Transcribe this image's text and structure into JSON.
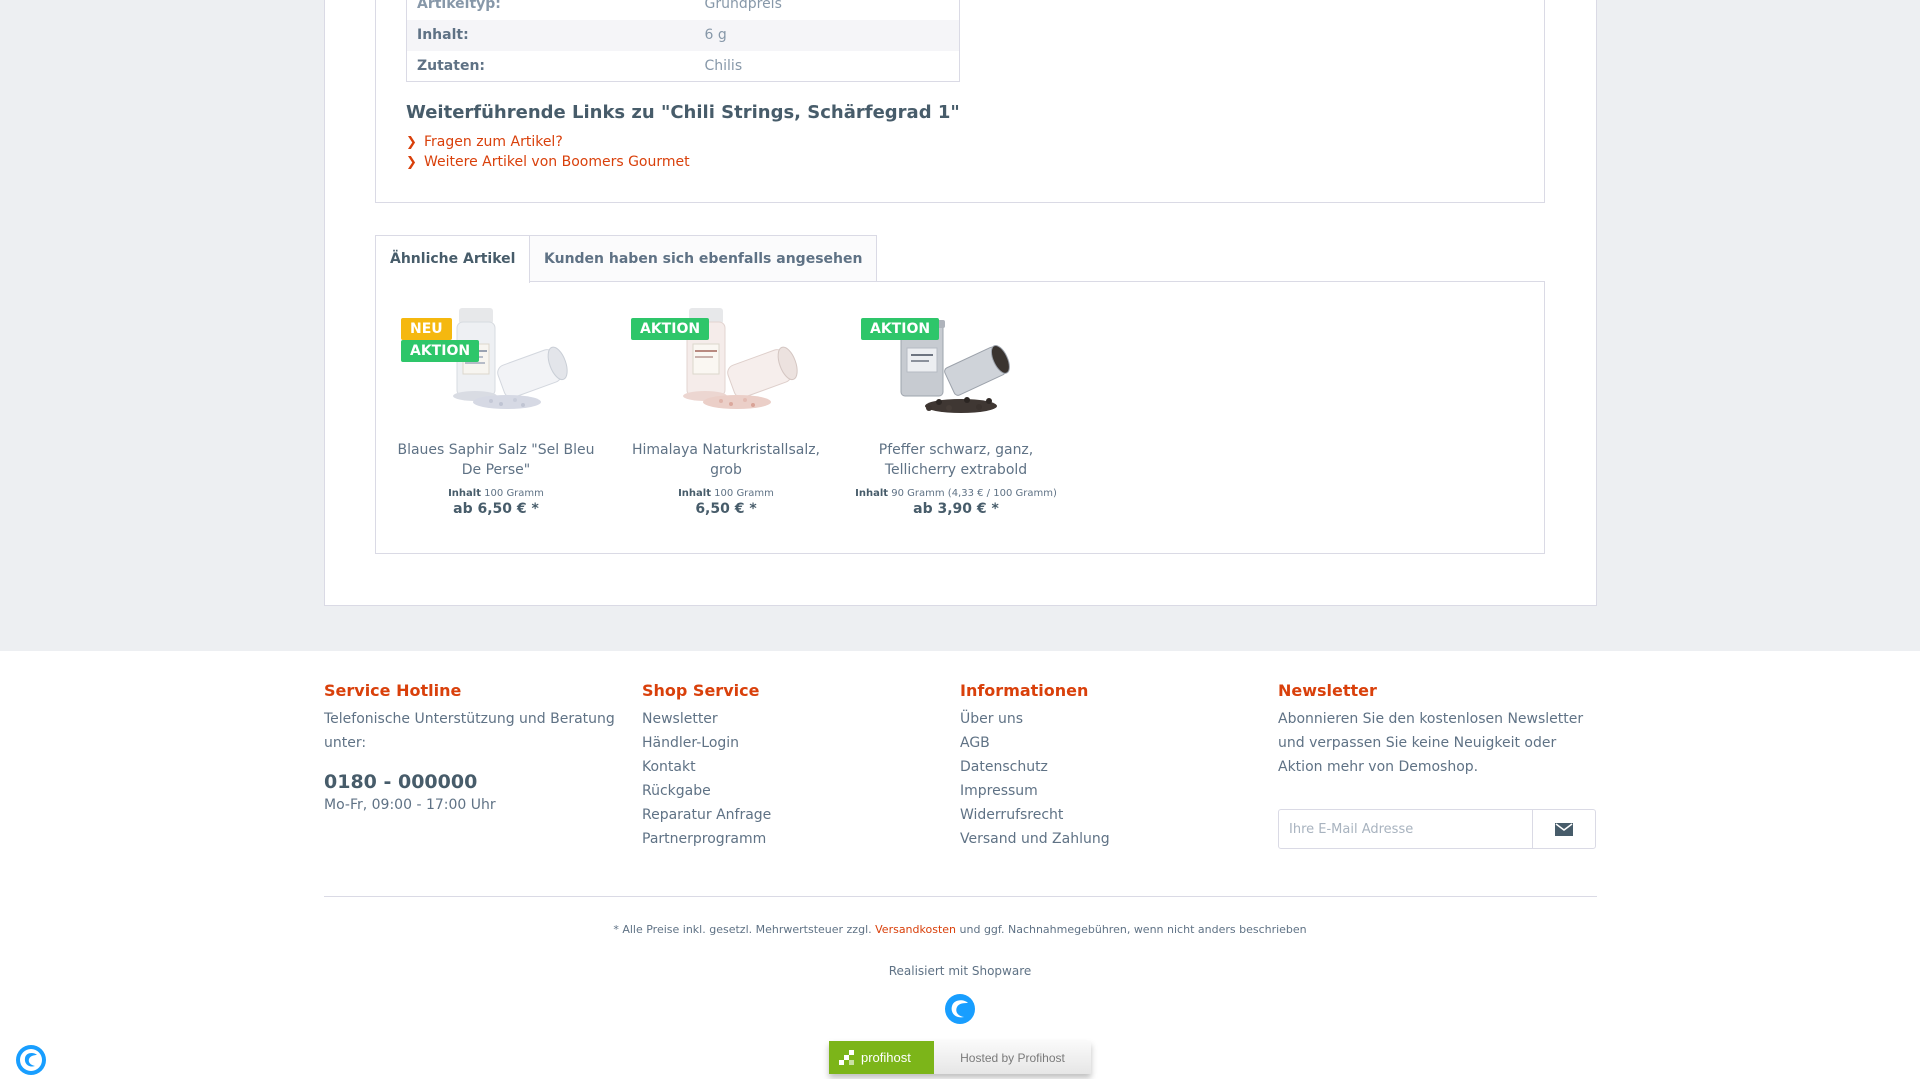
{
  "properties": [
    {
      "key": "Artikeltyp:",
      "value": "Grundpreis"
    },
    {
      "key": "Inhalt:",
      "value": "6 g"
    },
    {
      "key": "Zutaten:",
      "value": "Chilis"
    }
  ],
  "links_section": {
    "title": "Weiterführende Links zu \"Chili Strings, Schärfegrad 1\"",
    "links": [
      "Fragen zum Artikel?",
      "Weitere Artikel von Boomers Gourmet"
    ]
  },
  "tabs": {
    "similar": "Ähnliche Artikel",
    "also_viewed": "Kunden haben sich ebenfalls angesehen"
  },
  "products": [
    {
      "badges": [
        {
          "label": "NEU",
          "color": "#f5b80f"
        },
        {
          "label": "AKTION",
          "color": "#2ec66a"
        }
      ],
      "name": "Blaues Saphir Salz \"Sel Bleu De Perse\"",
      "unit_label": "Inhalt",
      "unit_value": "100 Gramm",
      "price": "ab 6,50 € *"
    },
    {
      "badges": [
        {
          "label": "AKTION",
          "color": "#2ec66a"
        }
      ],
      "name": "Himalaya Naturkristallsalz, grob",
      "unit_label": "Inhalt",
      "unit_value": "100 Gramm",
      "price": "6,50 € *"
    },
    {
      "badges": [
        {
          "label": "AKTION",
          "color": "#2ec66a"
        }
      ],
      "name": "Pfeffer schwarz, ganz, Tellicherry extrabold",
      "unit_label": "Inhalt",
      "unit_value": "90 Gramm (4,33 € / 100 Gramm)",
      "price": "ab 3,90 € *"
    }
  ],
  "footer": {
    "hotline": {
      "title": "Service Hotline",
      "text": "Telefonische Unterstützung und Beratung unter:",
      "phone": "0180 - 000000",
      "hours": "Mo-Fr, 09:00 - 17:00 Uhr"
    },
    "shop_service": {
      "title": "Shop Service",
      "items": [
        "Newsletter",
        "Händler-Login",
        "Kontakt",
        "Rückgabe",
        "Reparatur Anfrage",
        "Partnerprogramm"
      ]
    },
    "info": {
      "title": "Informationen",
      "items": [
        "Über uns",
        "AGB",
        "Datenschutz",
        "Impressum",
        "Widerrufsrecht",
        "Versand und Zahlung"
      ]
    },
    "newsletter": {
      "title": "Newsletter",
      "text": "Abonnieren Sie den kostenlosen Newsletter und verpassen Sie keine Neuigkeit oder Aktion mehr von Demoshop.",
      "placeholder": "Ihre E-Mail Adresse"
    },
    "vat_note_before": "* Alle Preise inkl. gesetzl. Mehrwertsteuer zzgl.",
    "vat_note_link": "Versandkosten",
    "vat_note_after": "und ggf. Nachnahmegebühren, wenn nicht anders beschrieben",
    "realised": "Realisiert mit Shopware",
    "profihost_brand": "profihost",
    "profihost_text": "Hosted by Profihost"
  },
  "colors": {
    "accent": "#d9400b",
    "text": "#5f7285",
    "heading": "#475c6a",
    "background_grey": "#edeff2",
    "shopware_blue": "#189eff"
  }
}
